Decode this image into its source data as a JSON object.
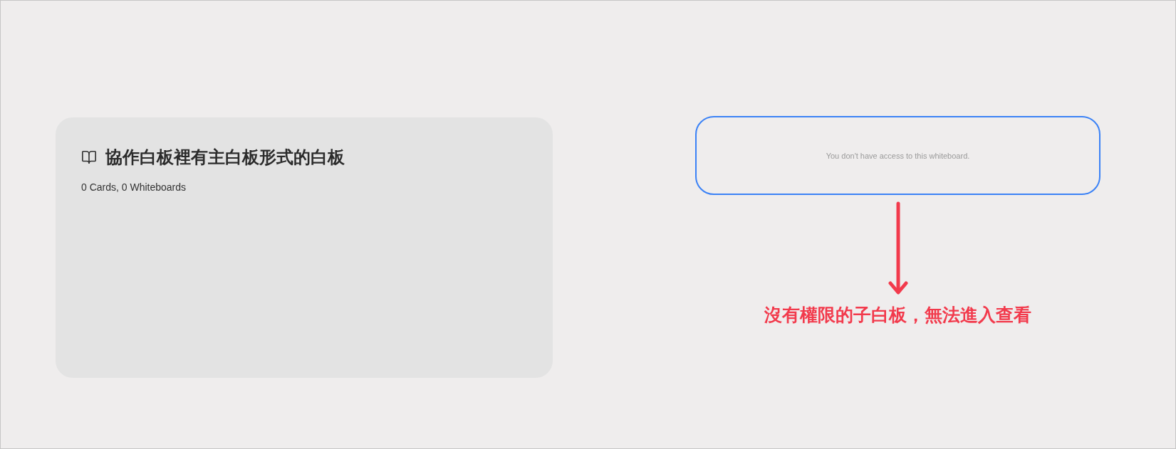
{
  "board_card": {
    "title": "協作白板裡有主白板形式的白板",
    "subtitle": "0 Cards, 0 Whiteboards"
  },
  "locked_board": {
    "message": "You don't have access to this whiteboard."
  },
  "annotation": {
    "text": "沒有權限的子白板，無法進入查看"
  }
}
